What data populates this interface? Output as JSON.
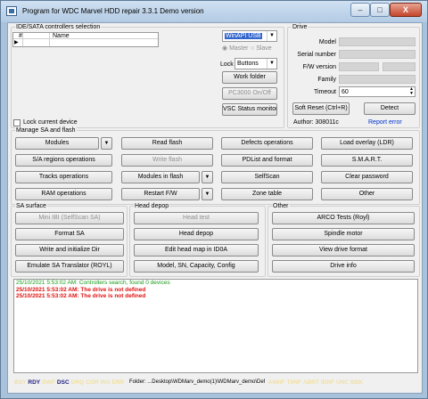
{
  "window": {
    "title": "Program for WDC Marvel HDD repair 3.3.1 Demo version",
    "min": "–",
    "max": "□",
    "close": "X"
  },
  "ide": {
    "title": "IDE/SATA controllers selection",
    "col_num": "#",
    "col_name": "Name",
    "adapter": "WinAPI USB",
    "master": "Master",
    "slave": "Slave",
    "lock_label": "Lock",
    "lock_value": "Buttons",
    "work_folder": "Work folder",
    "pc3000": "PC3000 On/Off",
    "vsc": "VSC Status monitoring",
    "lock_device": "Lock current device"
  },
  "drive": {
    "title": "Drive",
    "model": "Model",
    "serial": "Serial number",
    "fw": "F/W version",
    "family": "Family",
    "timeout": "Timeout",
    "timeout_value": "60",
    "soft_reset": "Soft Reset (Ctrl+R)",
    "detect": "Detect",
    "author": "Author: 308011c",
    "report": "Report error"
  },
  "manage": {
    "title": "Manage SA and flash",
    "modules": "Modules",
    "read_flash": "Read flash",
    "defects": "Defects operations",
    "load_overlay": "Load overlay (LDR)",
    "sa_regions": "S/A regions operations",
    "write_flash": "Write flash",
    "pdlist": "PDList and format",
    "smart": "S.M.A.R.T.",
    "tracks": "Tracks operations",
    "modules_flash": "Modules in flash",
    "selfscan": "SelfScan",
    "clear_password": "Clear password",
    "ram": "RAM operations",
    "restart": "Restart F/W",
    "zone": "Zone table",
    "other": "Other"
  },
  "sa_surface": {
    "title": "SA surface",
    "mini_ibi": "Mini IBI (SelfScan SA)",
    "format": "Format SA",
    "write_init": "Write and initialize Dir",
    "emulate": "Emulate SA Translator (ROYL)"
  },
  "head_depop": {
    "title": "Head depop",
    "head_test": "Head test",
    "head_depop": "Head depop",
    "edit_head": "Edit head map in ID0A",
    "model_sn": "Model, SN, Capacity, Config"
  },
  "other": {
    "title": "Other",
    "arco": "ARCO Tests (Royl)",
    "spindle": "Spindle motor",
    "view_format": "View drive format",
    "drive_info": "Drive info"
  },
  "log": [
    {
      "text": "25/10/2021 5:53:02 AM: Controllers search, found 0 devices",
      "color": "#1a9a1a",
      "bold": false
    },
    {
      "text": "25/10/2021 5:53:02 AM: The drive is not defined",
      "color": "#e01010",
      "bold": true
    },
    {
      "text": "25/10/2021 5:53:02 AM: The drive is not defined",
      "color": "#e01010",
      "bold": true
    }
  ],
  "status": {
    "regs": [
      {
        "t": "BSY",
        "on": false
      },
      {
        "t": "RDY",
        "on": true
      },
      {
        "t": "DWF",
        "on": false
      },
      {
        "t": "DSC",
        "on": true
      },
      {
        "t": "DRQ",
        "on": false
      },
      {
        "t": "COR",
        "on": false
      },
      {
        "t": "INX",
        "on": false
      },
      {
        "t": "ERR",
        "on": false
      }
    ],
    "folder": "Folder: ...Desktop\\WDMarv_demo(1)\\WDMarv_demo\\Default",
    "err": [
      {
        "t": "AMNF"
      },
      {
        "t": "T0NF"
      },
      {
        "t": "ABRT"
      },
      {
        "t": "IDNF"
      },
      {
        "t": "UNC"
      },
      {
        "t": "BBK"
      }
    ]
  }
}
